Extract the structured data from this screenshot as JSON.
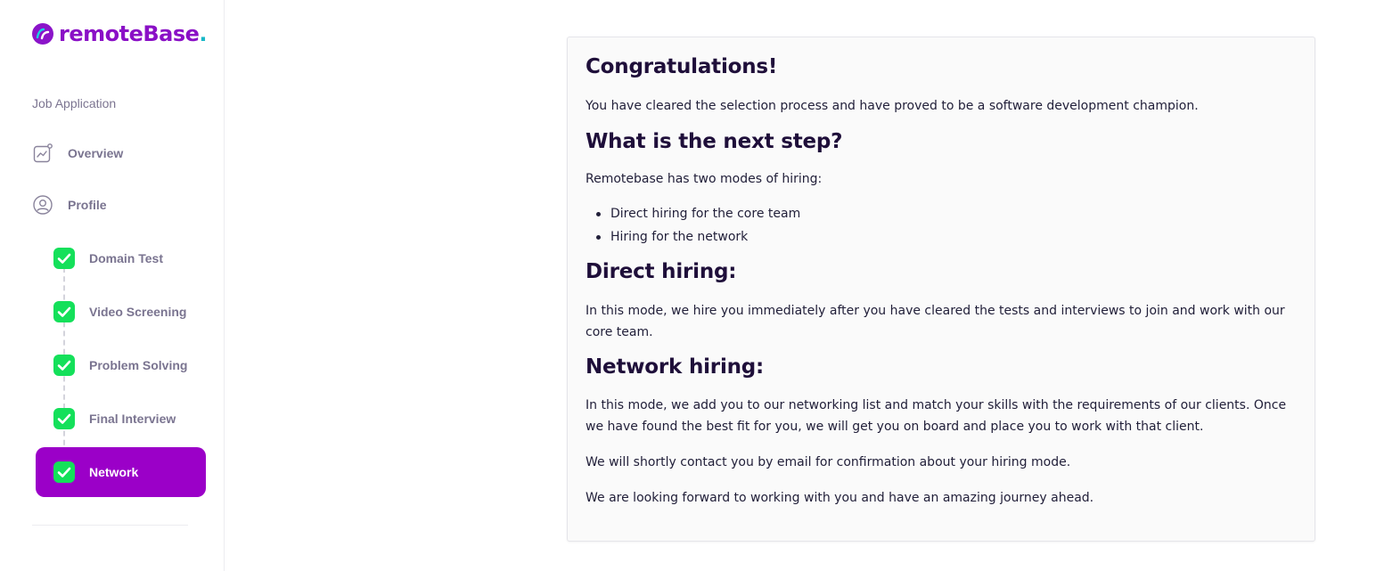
{
  "brand": {
    "name": "remoteBase",
    "dot": ".",
    "colors": {
      "primary": "#9b00c8",
      "accent": "#19b8c8",
      "success": "#14e05a"
    }
  },
  "sidebar": {
    "section_label": "Job Application",
    "nav": [
      {
        "label": "Overview",
        "icon": "chart-icon"
      },
      {
        "label": "Profile",
        "icon": "user-icon"
      }
    ],
    "steps": [
      {
        "label": "Domain Test",
        "status": "completed"
      },
      {
        "label": "Video Screening",
        "status": "completed"
      },
      {
        "label": "Problem Solving",
        "status": "completed"
      },
      {
        "label": "Final Interview",
        "status": "completed"
      },
      {
        "label": "Network",
        "status": "completed",
        "active": true
      }
    ]
  },
  "content": {
    "congrats_title": "Congratulations!",
    "congrats_text": "You have cleared the selection process and have proved to be a software development champion.",
    "next_title": "What is the next step?",
    "modes_intro": "Remotebase has two modes of hiring:",
    "modes": [
      "Direct hiring for the core team",
      "Hiring for the network"
    ],
    "direct_title": "Direct hiring:",
    "direct_text": "In this mode, we hire you immediately after you have cleared the tests and interviews to join and work with our core team.",
    "network_title": "Network hiring:",
    "network_text": "In this mode, we add you to our networking list and match your skills with the requirements of our clients. Once we have found the best fit for you, we will get you on board and place you to work with that client.",
    "contact_text": "We will shortly contact you by email for confirmation about your hiring mode.",
    "forward_text": "We are looking forward to working with you and have an amazing journey ahead."
  }
}
